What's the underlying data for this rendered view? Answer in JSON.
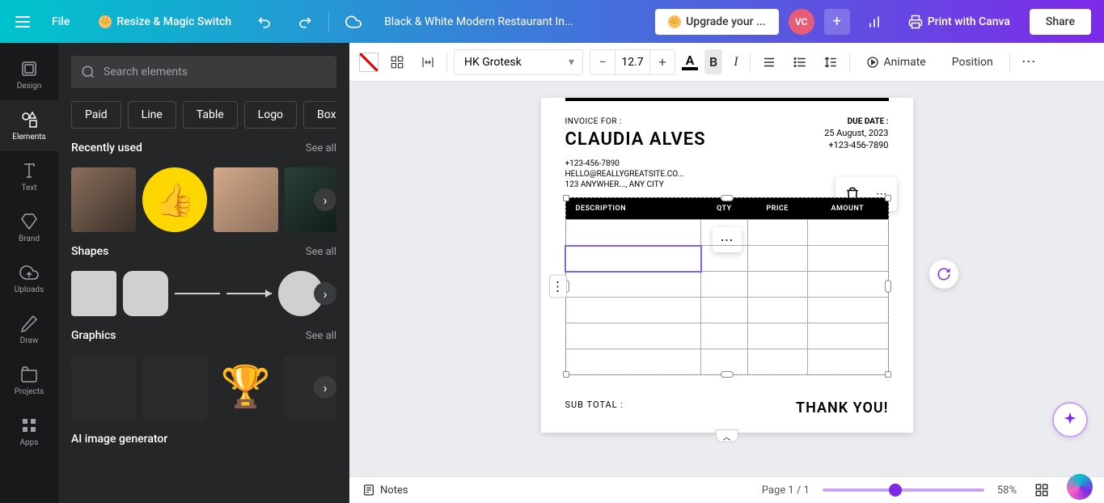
{
  "topbar": {
    "file_label": "File",
    "resize_label": "Resize & Magic Switch",
    "doc_title": "Black & White Modern Restaurant In...",
    "upgrade_label": "Upgrade your ...",
    "avatar_initials": "VC",
    "print_label": "Print with Canva",
    "share_label": "Share"
  },
  "leftnav": {
    "items": [
      {
        "label": "Design"
      },
      {
        "label": "Elements"
      },
      {
        "label": "Text"
      },
      {
        "label": "Brand"
      },
      {
        "label": "Uploads"
      },
      {
        "label": "Draw"
      },
      {
        "label": "Projects"
      },
      {
        "label": "Apps"
      }
    ]
  },
  "sidepanel": {
    "search_placeholder": "Search elements",
    "chips": [
      "Paid",
      "Line",
      "Table",
      "Logo",
      "Box"
    ],
    "sections": {
      "recently_used": {
        "title": "Recently used",
        "see_all": "See all"
      },
      "shapes": {
        "title": "Shapes",
        "see_all": "See all"
      },
      "graphics": {
        "title": "Graphics",
        "see_all": "See all"
      },
      "ai": {
        "title": "AI image generator"
      }
    }
  },
  "toolbar": {
    "font_name": "HK Grotesk",
    "font_size": "12.7",
    "animate_label": "Animate",
    "position_label": "Position"
  },
  "invoice": {
    "for_label": "INVOICE FOR :",
    "name": "CLAUDIA ALVES",
    "phone": "+123-456-7890",
    "email": "HELLO@REALLYGREATSITE.CO...",
    "address": "123 ANYWHER..., ANY CITY",
    "due_label": "DUE DATE :",
    "due_date": "25 August, 2023",
    "due_phone": "+123-456-7890",
    "table_headers": [
      "DESCRIPTION",
      "QTY",
      "PRICE",
      "AMOUNT"
    ],
    "subtotal_label": "SUB TOTAL :",
    "thankyou": "THANK YOU!"
  },
  "bottombar": {
    "notes_label": "Notes",
    "page_counter": "Page 1 / 1",
    "zoom_label": "58%"
  }
}
